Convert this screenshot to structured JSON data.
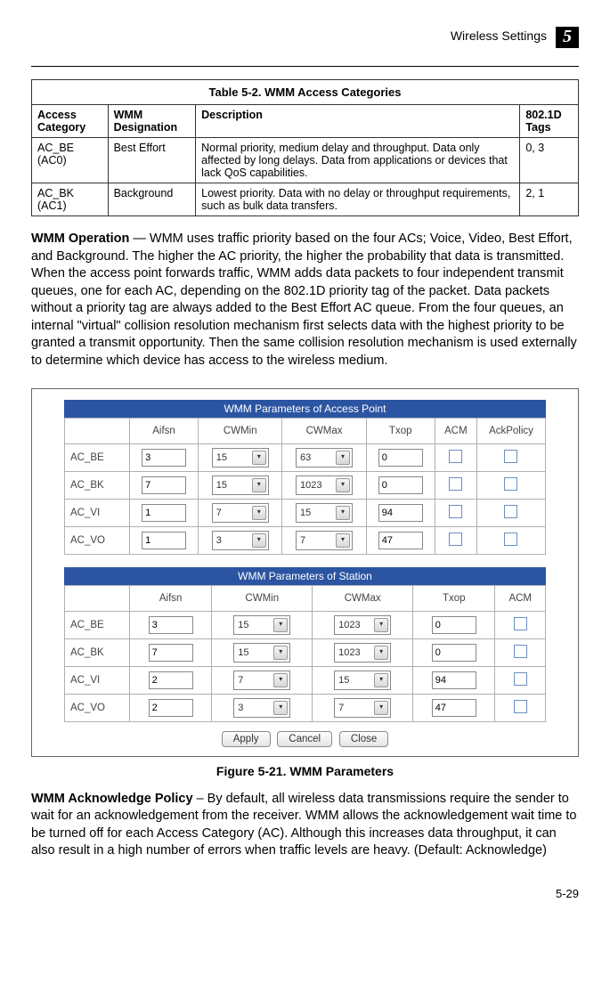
{
  "header": {
    "title": "Wireless Settings",
    "chapter": "5"
  },
  "table52": {
    "title": "Table 5-2. WMM Access Categories",
    "headers": {
      "c1": "Access Category",
      "c2": "WMM Designation",
      "c3": "Description",
      "c4": "802.1D Tags"
    },
    "rows": [
      {
        "c1": "AC_BE (AC0)",
        "c2": "Best Effort",
        "c3": "Normal priority, medium delay and throughput. Data only affected by long delays. Data from applications or devices that lack QoS capabilities.",
        "c4": "0, 3"
      },
      {
        "c1": "AC_BK (AC1)",
        "c2": "Background",
        "c3": "Lowest priority. Data with no delay or throughput requirements, such as bulk data transfers.",
        "c4": "2, 1"
      }
    ]
  },
  "para1": {
    "lead": "WMM Operation",
    "text": " — WMM uses traffic priority based on the four ACs; Voice, Video, Best Effort, and Background. The higher the AC priority, the higher the probability that data is transmitted. When the access point forwards traffic, WMM adds data packets to four independent transmit queues, one for each AC, depending on the 802.1D priority tag of the packet. Data packets without a priority tag are always added to the Best Effort AC queue. From the four queues, an internal \"virtual\" collision resolution mechanism first selects data with the highest priority to be granted a transmit opportunity. Then the same collision resolution mechanism is used externally to determine which device has access to the wireless medium."
  },
  "figure": {
    "ap": {
      "title": "WMM Parameters of Access Point",
      "headers": [
        "",
        "Aifsn",
        "CWMin",
        "CWMax",
        "Txop",
        "ACM",
        "AckPolicy"
      ],
      "rows": [
        {
          "label": "AC_BE",
          "aifsn": "3",
          "cwmin": "15",
          "cwmax": "63",
          "txop": "0"
        },
        {
          "label": "AC_BK",
          "aifsn": "7",
          "cwmin": "15",
          "cwmax": "1023",
          "txop": "0"
        },
        {
          "label": "AC_VI",
          "aifsn": "1",
          "cwmin": "7",
          "cwmax": "15",
          "txop": "94"
        },
        {
          "label": "AC_VO",
          "aifsn": "1",
          "cwmin": "3",
          "cwmax": "7",
          "txop": "47"
        }
      ]
    },
    "sta": {
      "title": "WMM Parameters of Station",
      "headers": [
        "",
        "Aifsn",
        "CWMin",
        "CWMax",
        "Txop",
        "ACM"
      ],
      "rows": [
        {
          "label": "AC_BE",
          "aifsn": "3",
          "cwmin": "15",
          "cwmax": "1023",
          "txop": "0"
        },
        {
          "label": "AC_BK",
          "aifsn": "7",
          "cwmin": "15",
          "cwmax": "1023",
          "txop": "0"
        },
        {
          "label": "AC_VI",
          "aifsn": "2",
          "cwmin": "7",
          "cwmax": "15",
          "txop": "94"
        },
        {
          "label": "AC_VO",
          "aifsn": "2",
          "cwmin": "3",
          "cwmax": "7",
          "txop": "47"
        }
      ]
    },
    "buttons": {
      "apply": "Apply",
      "cancel": "Cancel",
      "close": "Close"
    },
    "caption": "Figure 5-21.   WMM Parameters"
  },
  "para2": {
    "lead": "WMM Acknowledge Policy",
    "text": " – By default, all wireless data transmissions require the sender to wait for an acknowledgement from the receiver. WMM allows the acknowledgement wait time to be turned off for each Access Category (AC). Although this increases data throughput, it can also result in a high number of errors when traffic levels are heavy. (Default: Acknowledge)"
  },
  "page": "5-29"
}
